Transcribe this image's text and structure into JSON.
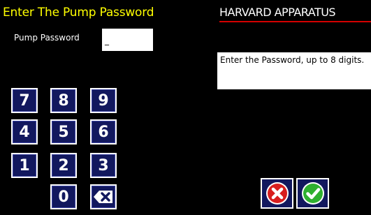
{
  "header": {
    "title": "Enter The Pump Password",
    "brand": "HARVARD APPARATUS"
  },
  "password": {
    "label": "Pump Password",
    "value": "_"
  },
  "help": {
    "text": "Enter the Password, up to 8 digits."
  },
  "keypad": {
    "keys": [
      "7",
      "8",
      "9",
      "4",
      "5",
      "6",
      "1",
      "2",
      "3",
      "0"
    ],
    "backspace_icon": "backspace-icon"
  },
  "actions": {
    "cancel_icon": "red-x-icon",
    "confirm_icon": "green-check-icon"
  },
  "colors": {
    "title": "#ffff00",
    "brand_underline": "#d40000",
    "key_fill": "#12185e",
    "cancel": "#d81e1e",
    "confirm": "#2fb02f"
  }
}
